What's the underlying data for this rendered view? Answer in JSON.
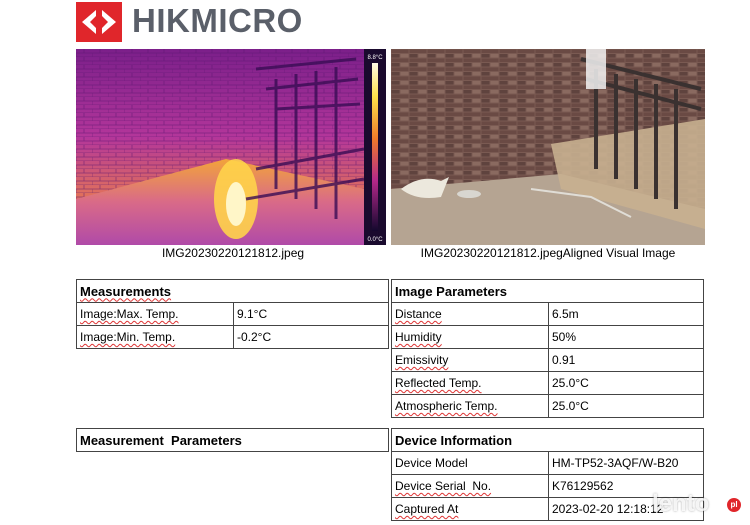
{
  "brand": {
    "name": "HIKMICRO",
    "color": "#e0262b"
  },
  "images": {
    "thermal": {
      "caption": "IMG20230220121812.jpeg",
      "scale_max": "8.8°C",
      "scale_min": "0.0°C"
    },
    "visual": {
      "caption": "IMG20230220121812.jpegAligned Visual Image"
    }
  },
  "measurements": {
    "title": "Measurements",
    "rows": [
      {
        "label": "Image:Max. Temp.",
        "value": "9.1°C"
      },
      {
        "label": "Image:Min. Temp.",
        "value": "-0.2°C"
      }
    ]
  },
  "image_parameters": {
    "title": "Image Parameters",
    "rows": [
      {
        "label": "Distance",
        "value": "6.5m"
      },
      {
        "label": "Humidity",
        "value": "50%"
      },
      {
        "label": "Emissivity",
        "value": "0.91"
      },
      {
        "label": "Reflected Temp.",
        "value": "25.0°C"
      },
      {
        "label": "Atmospheric Temp.",
        "value": "25.0°C"
      }
    ]
  },
  "measurement_parameters": {
    "title": "Measurement  Parameters"
  },
  "device_information": {
    "title": "Device Information",
    "rows": [
      {
        "label": "Device Model",
        "value": "HM-TP52-3AQF/W-B20"
      },
      {
        "label": "Device Serial  No.",
        "value": "K76129562"
      },
      {
        "label": "Captured At",
        "value": "2023-02-20 12:18:12"
      }
    ]
  },
  "watermark": {
    "text": "lento",
    "badge": "pl"
  }
}
